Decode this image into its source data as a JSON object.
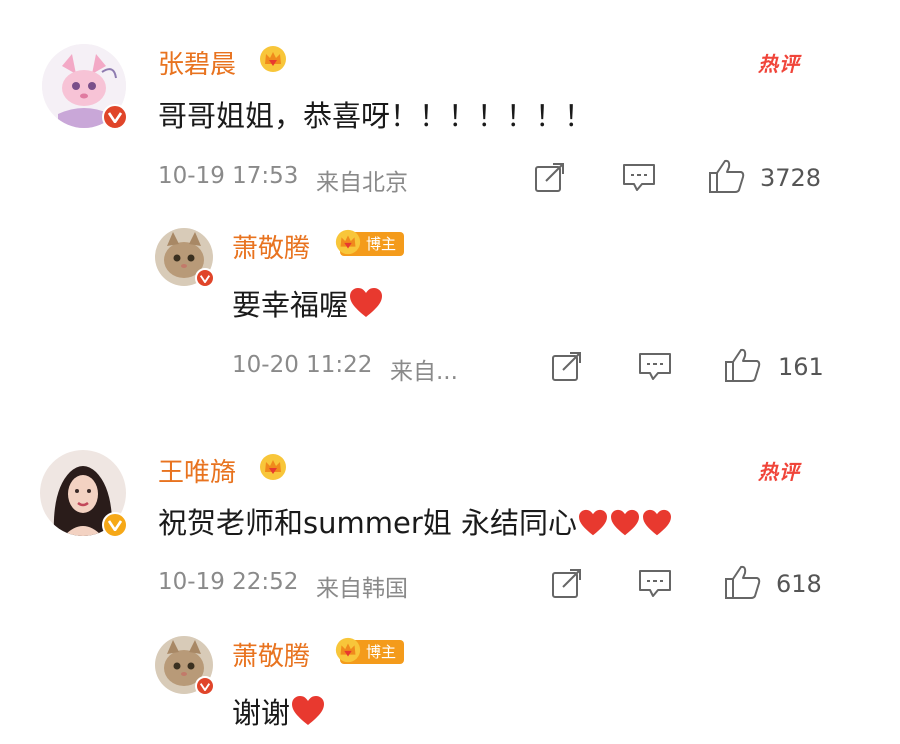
{
  "comments": [
    {
      "user": "张碧晨",
      "hot_label": "热评",
      "text": "哥哥姐姐，恭喜呀！！！！！！！",
      "time": "10-19 17:53",
      "location": "来自北京",
      "likes": "3728",
      "reply": {
        "user": "萧敬腾",
        "badge": "博主",
        "text": "要幸福喔",
        "time": "10-20 11:22",
        "location": "来自...",
        "likes": "161"
      }
    },
    {
      "user": "王唯旖",
      "hot_label": "热评",
      "text": "祝贺老师和summer姐 永结同心",
      "time": "10-19 22:52",
      "location": "来自韩国",
      "likes": "618",
      "reply": {
        "user": "萧敬腾",
        "badge": "博主",
        "text": "谢谢"
      }
    }
  ],
  "colors": {
    "username": "#e8731f",
    "hot": "#f0453a",
    "heart": "#e8392f",
    "meta": "#8a8a8a",
    "badge": "#f49b1b"
  },
  "icons": [
    "share-icon",
    "comment-icon",
    "like-icon",
    "heart-emoji",
    "crown-icon",
    "verified-icon"
  ]
}
